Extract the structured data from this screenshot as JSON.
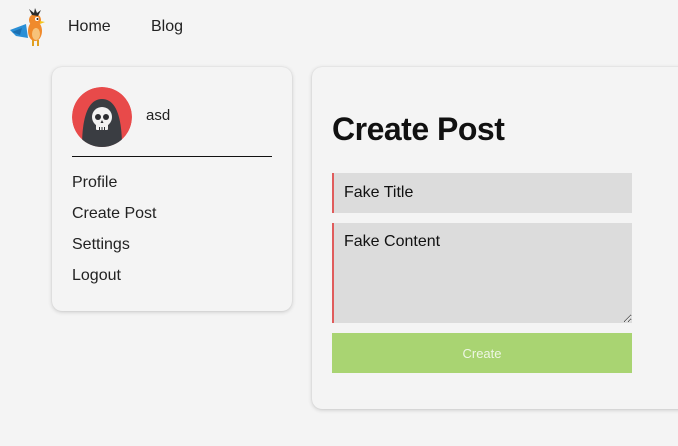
{
  "nav": {
    "home_label": "Home",
    "blog_label": "Blog"
  },
  "sidebar": {
    "username": "asd",
    "items": [
      {
        "label": "Profile"
      },
      {
        "label": "Create Post"
      },
      {
        "label": "Settings"
      },
      {
        "label": "Logout"
      }
    ]
  },
  "main": {
    "title": "Create Post",
    "title_field_value": "Fake Title",
    "content_field_value": "Fake Content",
    "create_label": "Create"
  },
  "colors": {
    "background": "#f4f4f4",
    "input_bg": "#dcdcdc",
    "input_accent": "#e05c5c",
    "button_bg": "#a9d472",
    "avatar_bg": "#e84a4a"
  },
  "icons": {
    "logo": "bird-mascot-icon",
    "avatar": "skull-avatar-icon"
  }
}
